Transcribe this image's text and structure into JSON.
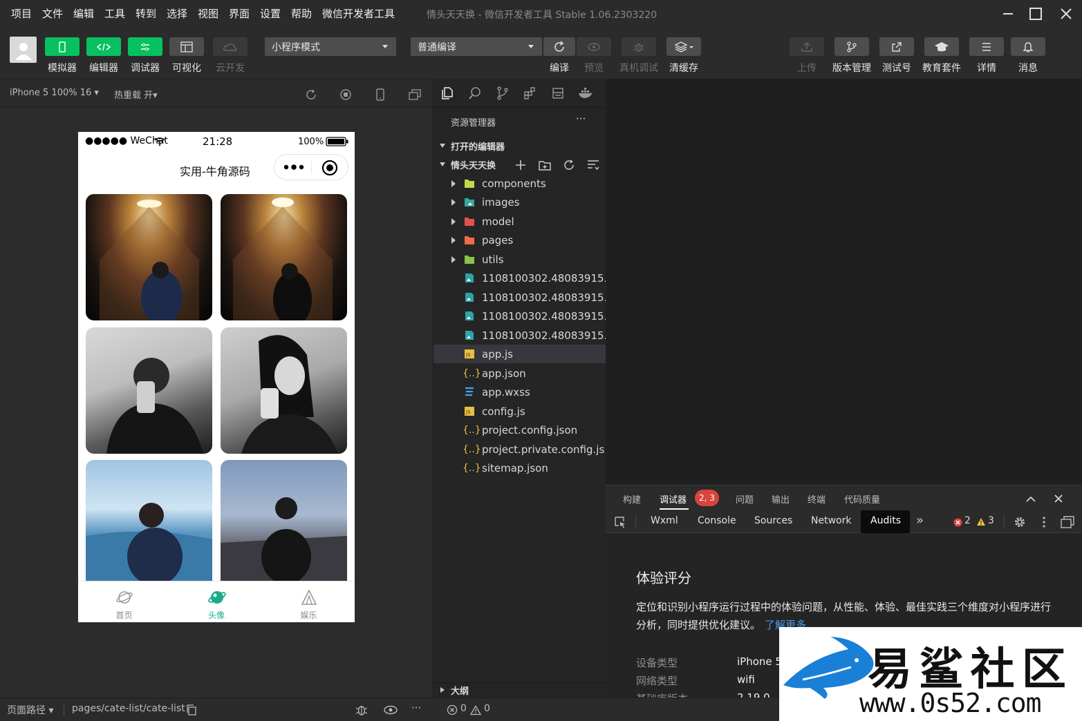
{
  "menubar": {
    "items": [
      "项目",
      "文件",
      "编辑",
      "工具",
      "转到",
      "选择",
      "视图",
      "界面",
      "设置",
      "帮助",
      "微信开发者工具"
    ],
    "window_title": "情头天天换 - 微信开发者工具 Stable 1.06.2303220"
  },
  "toolbar": {
    "simulator": "模拟器",
    "editor": "编辑器",
    "debugger": "调试器",
    "visual": "可视化",
    "cloud": "云开发",
    "mode_select": "小程序模式",
    "compile_select": "普通编译",
    "compile": "编译",
    "preview": "预览",
    "remote_debug": "真机调试",
    "clear_cache": "清缓存",
    "upload": "上传",
    "version": "版本管理",
    "test_account": "测试号",
    "edu": "教育套件",
    "details": "详情",
    "messages": "消息"
  },
  "simulator": {
    "device": "iPhone 5 100% 16",
    "hot_reload": "热重载 开",
    "status_carrier": "●●●●● WeChat",
    "status_time": "21:28",
    "status_battery": "100%",
    "nav_title": "实用-牛角源码",
    "tabs": [
      {
        "label": "首页",
        "active": false
      },
      {
        "label": "头像",
        "active": true
      },
      {
        "label": "娱乐",
        "active": false
      }
    ],
    "active_color": "#1aad8d"
  },
  "explorer": {
    "title": "资源管理器",
    "more": "···",
    "open_editors": "打开的编辑器",
    "project": "情头天天换",
    "outline": "大纲",
    "files": [
      {
        "name": "components",
        "type": "folder",
        "color": "#c6d74a"
      },
      {
        "name": "images",
        "type": "folder",
        "color": "#3aa6a0"
      },
      {
        "name": "model",
        "type": "folder",
        "color": "#e05252"
      },
      {
        "name": "pages",
        "type": "folder",
        "color": "#ef6b4a"
      },
      {
        "name": "utils",
        "type": "folder",
        "color": "#8bc34a"
      },
      {
        "name": "1108100302.48083915...",
        "type": "image"
      },
      {
        "name": "1108100302.48083915...",
        "type": "image"
      },
      {
        "name": "1108100302.48083915...",
        "type": "image"
      },
      {
        "name": "1108100302.48083915...",
        "type": "image"
      },
      {
        "name": "app.js",
        "type": "js",
        "selected": true
      },
      {
        "name": "app.json",
        "type": "json"
      },
      {
        "name": "app.wxss",
        "type": "css"
      },
      {
        "name": "config.js",
        "type": "js"
      },
      {
        "name": "project.config.json",
        "type": "json"
      },
      {
        "name": "project.private.config.js...",
        "type": "json"
      },
      {
        "name": "sitemap.json",
        "type": "json"
      }
    ]
  },
  "debug": {
    "tabs": [
      "构建",
      "调试器",
      "问题",
      "输出",
      "终端",
      "代码质量"
    ],
    "badge": "2, 3",
    "devtools_tabs": [
      "Wxml",
      "Console",
      "Sources",
      "Network",
      "Audits"
    ],
    "more_tabs": "»",
    "errors": "2",
    "warnings": "3",
    "audit": {
      "title": "体验评分",
      "desc": "定位和识别小程序运行过程中的体验问题，从性能、体验、最佳实践三个维度对小程序进行分析，同时提供优化建议。",
      "link": "了解更多",
      "rows": [
        {
          "label": "设备类型",
          "value": "iPhone 5"
        },
        {
          "label": "网络类型",
          "value": "wifi"
        },
        {
          "label": "基础库版本",
          "value": "2.19.0"
        }
      ]
    }
  },
  "statusbar": {
    "page_path_label": "页面路径",
    "page_path": "pages/cate-list/cate-list",
    "errors": "0",
    "warnings": "0",
    "more": "···"
  },
  "watermark": {
    "brand": "易 鲨 社 区",
    "url": "www.0s52.com"
  }
}
